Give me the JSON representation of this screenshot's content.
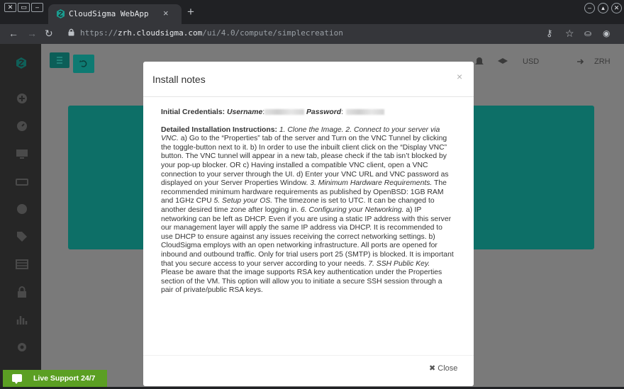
{
  "browser": {
    "tab_title": "CloudSigma WebApp",
    "tab_close": "×",
    "new_tab": "+",
    "url_scheme": "https://",
    "url_host": "zrh.cloudsigma.com",
    "url_path": "/ui/4.0/compute/simplecreation"
  },
  "header": {
    "currency": "USD",
    "location": "ZRH"
  },
  "modal": {
    "title": "Install notes",
    "close_x": "×",
    "credentials_label": "Initial Credentials:",
    "username_label": "Username",
    "password_label": "Password",
    "instructions_label": "Detailed Installation Instructions:",
    "segments": [
      {
        "i": "1. Clone the Image. 2. Connect to your server via VNC."
      },
      {
        "t": " a) Go to the “Properties” tab of the server and Turn on the VNC Tunnel by clicking the toggle-button next to it. b) In order to use the inbuilt client click on the “Display VNC” button. The VNC tunnel will appear in a new tab, please check if the tab isn’t blocked by your pop-up blocker. OR c) Having installed a compatible VNC client, open a VNC connection to your server through the UI. d) Enter your VNC URL and VNC password as displayed on your Server Properties Window. "
      },
      {
        "i": "3. Minimum Hardware Requirements."
      },
      {
        "t": " The recommended minimum hardware requirements as published by OpenBSD: 1GB RAM and 1GHz CPU "
      },
      {
        "i": "5. Setup your OS."
      },
      {
        "t": " The timezone is set to UTC. It can be changed to another desired time zone after logging in. "
      },
      {
        "i": "6. Configuring your Networking."
      },
      {
        "t": " a) IP networking can be left as DHCP. Even if you are using a static IP address with this server our management layer will apply the same IP address via DHCP. It is recommended to use DHCP to ensure against any issues receiving the correct networking settings. b) CloudSigma employs with an open networking infrastructure. All ports are opened for inbound and outbound traffic. Only for trial users port 25 (SMTP) is blocked. It is important that you secure access to your server according to your needs. "
      },
      {
        "i": "7. SSH Public Key."
      }
    ],
    "footer_paragraph": "Please be aware that the image supports RSA key authentication under the Properties section of the VM. This option will allow you to initiate a secure SSH session through a pair of private/public RSA keys.",
    "close_label": "Close"
  },
  "live_support": {
    "label": "Live Support 24/7"
  },
  "colors": {
    "teal": "#0d6f67",
    "live_green": "#5b9f23"
  }
}
